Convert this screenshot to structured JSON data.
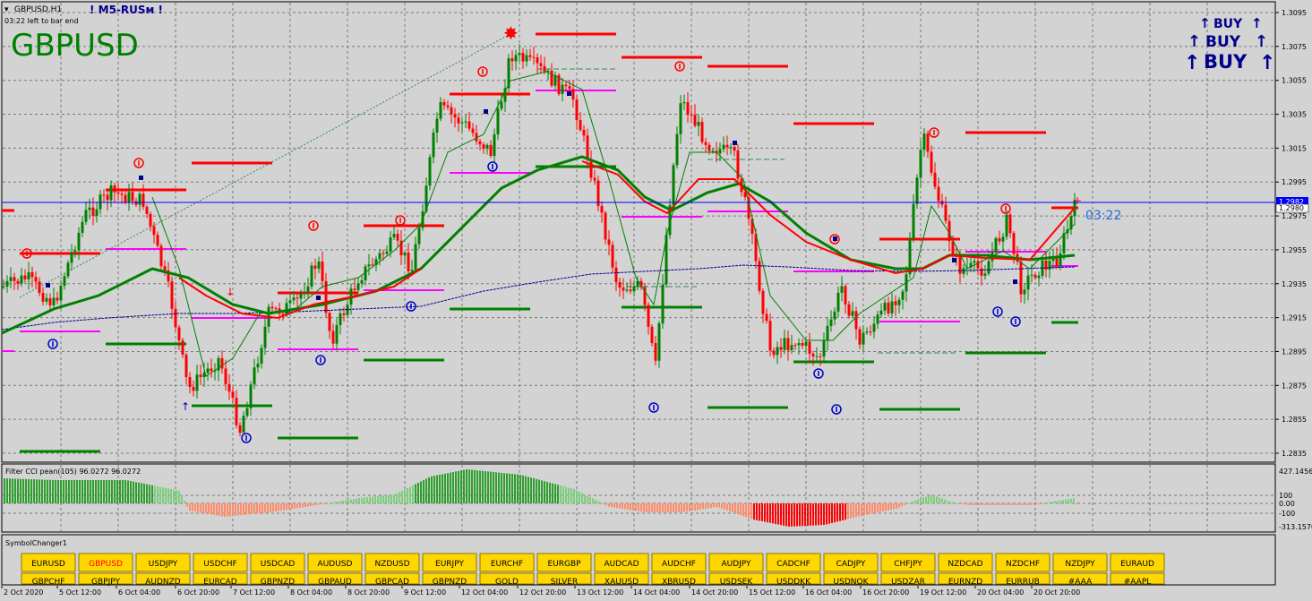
{
  "header": {
    "symbol_timeframe": "GBPUSD,H1",
    "indicator_name": "! M5-RUSм !",
    "bar_countdown": "03:22 left to bar end",
    "big_symbol": "GBPUSD"
  },
  "signals": {
    "buy_lines": [
      "BUY",
      "BUY",
      "BUY"
    ]
  },
  "price_axis": {
    "ticks": [
      "1.3095",
      "1.3075",
      "1.3055",
      "1.3035",
      "1.3015",
      "1.2995",
      "1.2975",
      "1.2955",
      "1.2935",
      "1.2915",
      "1.2895",
      "1.2875",
      "1.2855",
      "1.2835"
    ],
    "current_price_tags": [
      "1.2982",
      "1.2980"
    ],
    "countdown_label": "03:22"
  },
  "cci_panel": {
    "title": "Filter CCI pean(105)  96.0272 96.0272",
    "axis_labels": [
      "427.1456",
      "100",
      "0.00",
      "-100",
      "-313.1570"
    ]
  },
  "symbol_changer": {
    "title": "SymbolChanger1",
    "row1": [
      "EURUSD",
      "GBPUSD",
      "USDJPY",
      "USDCHF",
      "USDCAD",
      "AUDUSD",
      "NZDUSD",
      "EURJPY",
      "EURCHF",
      "EURGBP",
      "AUDCAD",
      "AUDCHF",
      "AUDJPY",
      "CADCHF",
      "CADJPY",
      "CHFJPY",
      "NZDCAD",
      "NZDCHF",
      "NZDJPY",
      "EURAUD"
    ],
    "active": "GBPUSD",
    "row2_partial": [
      "GBPCHF",
      "GBPJPY",
      "AUDNZD",
      "EURCAD",
      "GBPNZD",
      "GBPAUD",
      "GBPCAD",
      "GBPNZD",
      "GOLD",
      "SILVER",
      "XAUUSD",
      "XBRUSD",
      "USDSEK",
      "USDDKK",
      "USDNOK",
      "USDZAR",
      "EURNZD",
      "EURRUB",
      "#AAA",
      "#AAPL"
    ]
  },
  "time_axis": {
    "labels": [
      "2 Oct 2020",
      "5 Oct 12:00",
      "6 Oct 04:00",
      "6 Oct 20:00",
      "7 Oct 12:00",
      "8 Oct 04:00",
      "8 Oct 20:00",
      "9 Oct 12:00",
      "12 Oct 04:00",
      "12 Oct 20:00",
      "13 Oct 12:00",
      "14 Oct 04:00",
      "14 Oct 20:00",
      "15 Oct 12:00",
      "16 Oct 04:00",
      "16 Oct 20:00",
      "19 Oct 12:00",
      "20 Oct 04:00",
      "20 Oct 20:00"
    ]
  },
  "colors": {
    "background": "#d3d3d3",
    "bull_candle": "#008000",
    "bear_candle": "#ff0000",
    "resistance": "#ff0000",
    "support": "#008000",
    "mid_level": "#ff00ff",
    "current_price_line": "#0000ff",
    "button_bg": "#ffd700",
    "active_button_text": "#ff0000",
    "buy_text": "#00008b"
  }
}
